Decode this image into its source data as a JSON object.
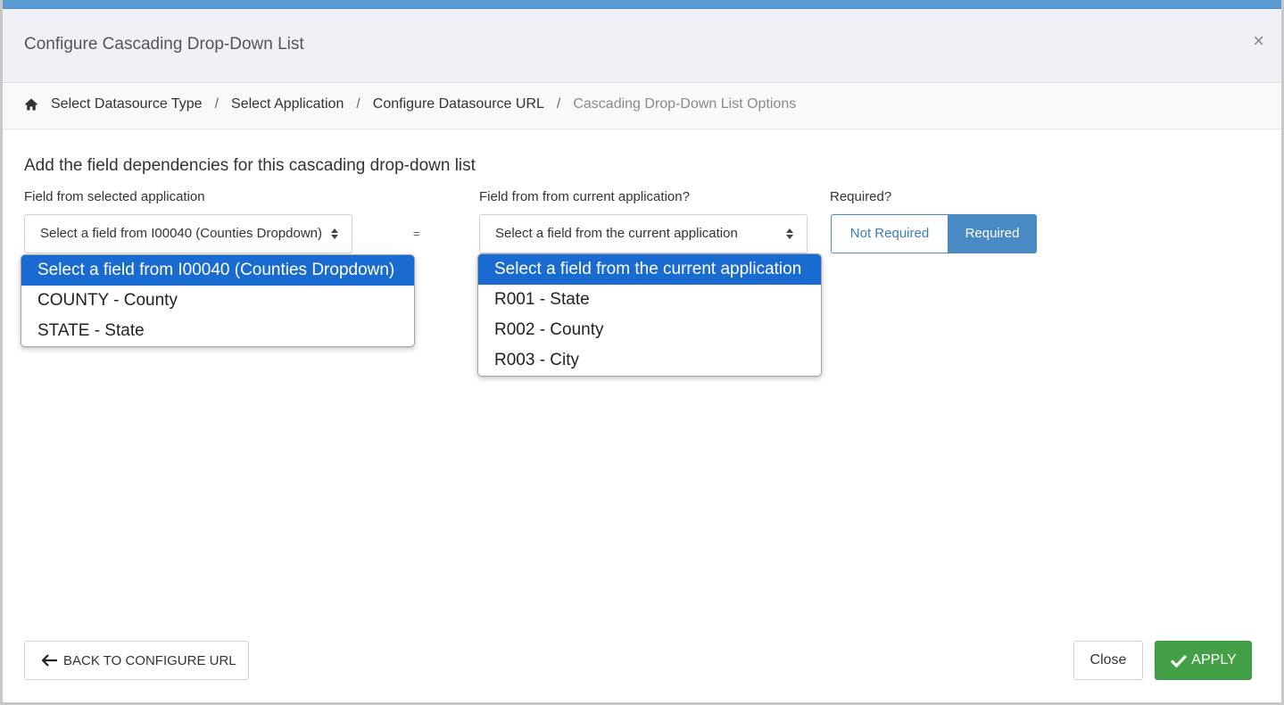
{
  "modal": {
    "title": "Configure Cascading Drop-Down List",
    "close_symbol": "×"
  },
  "breadcrumb": {
    "home_icon": "home-icon",
    "separator": "/",
    "items": [
      {
        "label": "Select Datasource Type",
        "active": false
      },
      {
        "label": "Select Application",
        "active": false
      },
      {
        "label": "Configure Datasource URL",
        "active": false
      },
      {
        "label": "Cascading Drop-Down List Options",
        "active": true
      }
    ]
  },
  "main": {
    "section_title": "Add the field dependencies for this cascading drop-down list",
    "left_label": "Field from selected application",
    "right_label": "Field from from current application?",
    "required_label": "Required?",
    "equals": "=",
    "left_select": {
      "value": "Select a field from I00040 (Counties Dropdown)",
      "options": [
        {
          "label": "Select a field from I00040 (Counties Dropdown)",
          "selected": true
        },
        {
          "label": "COUNTY - County",
          "selected": false
        },
        {
          "label": "STATE - State",
          "selected": false
        }
      ]
    },
    "right_select": {
      "value": "Select a field from the current application",
      "options": [
        {
          "label": "Select a field from the current application",
          "selected": true
        },
        {
          "label": "R001 - State",
          "selected": false
        },
        {
          "label": "R002 - County",
          "selected": false
        },
        {
          "label": "R003 - City",
          "selected": false
        }
      ]
    },
    "required_toggle": {
      "not_required_label": "Not Required",
      "required_label": "Required",
      "selected": "Required"
    }
  },
  "footer": {
    "back_label": "BACK TO CONFIGURE URL",
    "close_label": "Close",
    "apply_label": "APPLY"
  },
  "colors": {
    "accent": "#4a8ac4",
    "apply": "#43a047",
    "dropdown_highlight": "#1a6bd1"
  }
}
